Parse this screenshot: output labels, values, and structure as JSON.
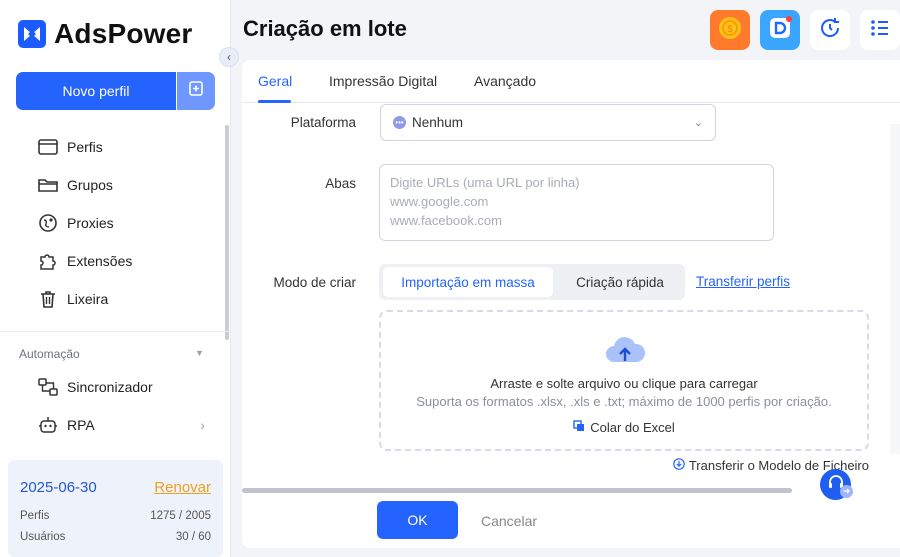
{
  "app": {
    "name": "AdsPower"
  },
  "sidebar": {
    "new_profile_label": "Novo perfil",
    "items": [
      {
        "label": "Perfis",
        "icon": "browser-window-icon"
      },
      {
        "label": "Grupos",
        "icon": "folder-icon"
      },
      {
        "label": "Proxies",
        "icon": "globe-pin-icon"
      },
      {
        "label": "Extensões",
        "icon": "puzzle-icon"
      },
      {
        "label": "Lixeira",
        "icon": "trash-icon"
      }
    ],
    "automation_label": "Automação",
    "automation_items": [
      {
        "label": "Sincronizador",
        "icon": "sync-icon"
      },
      {
        "label": "RPA",
        "icon": "robot-icon"
      }
    ],
    "plan": {
      "date": "2025-06-30",
      "renew": "Renovar",
      "profiles_label": "Perfis",
      "profiles_value": "1275 / 2005",
      "users_label": "Usuários",
      "users_value": "30 / 60"
    }
  },
  "header": {
    "title": "Criação em lote"
  },
  "tabs": [
    "Geral",
    "Impressão Digital",
    "Avançado"
  ],
  "form": {
    "platform_label": "Plataforma",
    "platform_value": "Nenhum",
    "tabs_label": "Abas",
    "tabs_placeholder_lines": [
      "Digite URLs (uma URL por linha)",
      "www.google.com",
      "www.facebook.com"
    ],
    "mode_label": "Modo de criar",
    "mode_options": [
      "Importação em massa",
      "Criação rápida"
    ],
    "mode_selected": "Importação em massa",
    "transfer_link": "Transferir perfis",
    "dropzone": {
      "title": "Arraste e solte arquivo ou clique para carregar",
      "subtitle": "Suporta os formatos .xlsx, .xls e .txt; máximo de 1000 perfis por criação.",
      "paste": "Colar do Excel"
    },
    "download_template": "Transferir o Modelo de Ficheiro"
  },
  "footer": {
    "ok": "OK",
    "cancel": "Cancelar"
  },
  "colors": {
    "accent": "#2563ff",
    "renew": "#f0a020"
  }
}
